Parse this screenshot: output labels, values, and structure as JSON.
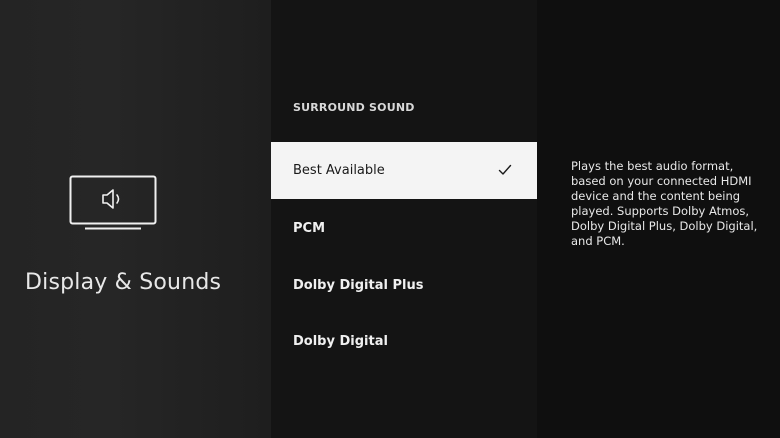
{
  "left_panel": {
    "icon": "tv-speaker-icon",
    "title": "Display & Sounds"
  },
  "menu": {
    "heading": "SURROUND SOUND",
    "options": [
      {
        "label": "Best Available",
        "selected": true
      },
      {
        "label": "PCM",
        "selected": false
      },
      {
        "label": "Dolby Digital Plus",
        "selected": false
      },
      {
        "label": "Dolby Digital",
        "selected": false
      }
    ],
    "check_icon": "checkmark-icon"
  },
  "description": {
    "text": "Plays the best audio format, based on your connected HDMI device and the content being played. Supports Dolby Atmos, Dolby Digital Plus, Dolby Digital, and PCM."
  }
}
